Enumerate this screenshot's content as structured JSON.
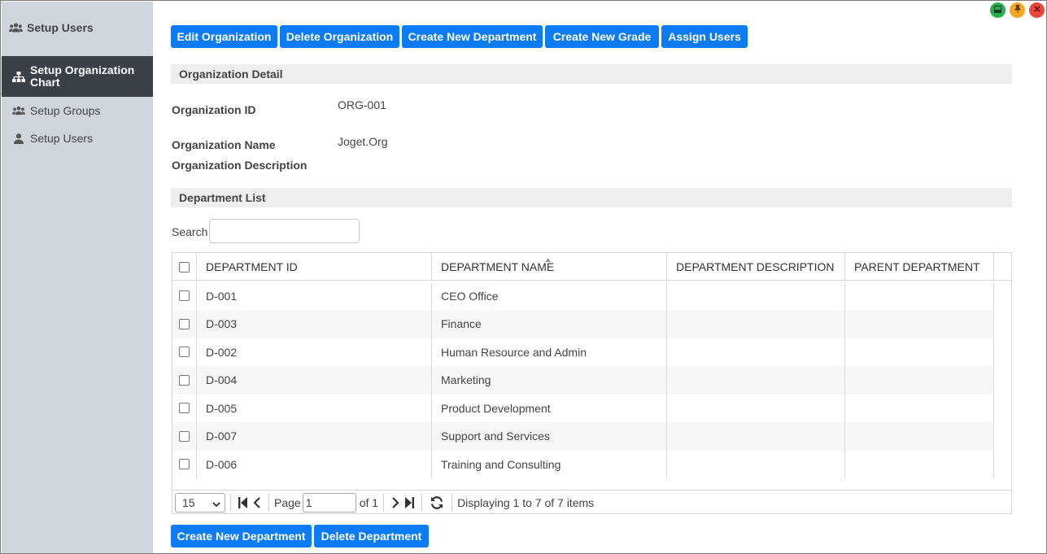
{
  "sidebar": {
    "title": "Setup Users",
    "items": [
      {
        "label": "Setup Organization Chart",
        "icon": "sitemap-icon",
        "active": true
      },
      {
        "label": "Setup Groups",
        "icon": "users-icon",
        "active": false
      },
      {
        "label": "Setup Users",
        "icon": "user-icon",
        "active": false
      }
    ]
  },
  "window_controls": [
    {
      "name": "green-window-button",
      "color": "#22b14c"
    },
    {
      "name": "orange-pin-button",
      "color": "#f5a623"
    },
    {
      "name": "red-close-button",
      "color": "#e8453c"
    }
  ],
  "toolbar": {
    "buttons": [
      "Edit Organization",
      "Delete Organization",
      "Create New Department",
      "Create New Grade",
      "Assign Users"
    ]
  },
  "org_detail": {
    "section_title": "Organization Detail",
    "id_label": "Organization ID",
    "id_value": "ORG-001",
    "name_label": "Organization Name",
    "name_value": "Joget.Org",
    "description_label": "Organization Description",
    "description_value": ""
  },
  "department_list": {
    "section_title": "Department List",
    "search_label": "Search",
    "search_value": "",
    "columns": [
      "DEPARTMENT ID",
      "DEPARTMENT NAME",
      "DEPARTMENT DESCRIPTION",
      "PARENT DEPARTMENT"
    ],
    "rows": [
      {
        "id": "D-001",
        "name": "CEO Office",
        "description": "",
        "parent": ""
      },
      {
        "id": "D-003",
        "name": "Finance",
        "description": "",
        "parent": ""
      },
      {
        "id": "D-002",
        "name": "Human Resource and Admin",
        "description": "",
        "parent": ""
      },
      {
        "id": "D-004",
        "name": "Marketing",
        "description": "",
        "parent": ""
      },
      {
        "id": "D-005",
        "name": "Product Development",
        "description": "",
        "parent": ""
      },
      {
        "id": "D-007",
        "name": "Support and Services",
        "description": "",
        "parent": ""
      },
      {
        "id": "D-006",
        "name": "Training and Consulting",
        "description": "",
        "parent": ""
      }
    ],
    "pager": {
      "page_size": "15",
      "page_label": "Page",
      "page_value": "1",
      "of_label": "of 1",
      "display_text": "Displaying 1 to 7 of 7 items"
    }
  },
  "bottom_buttons": [
    "Create New Department",
    "Delete Department"
  ],
  "colors": {
    "accent": "#0d7cf2",
    "sidebar_bg": "#d0d5dc",
    "sidebar_active": "#3b4046"
  }
}
